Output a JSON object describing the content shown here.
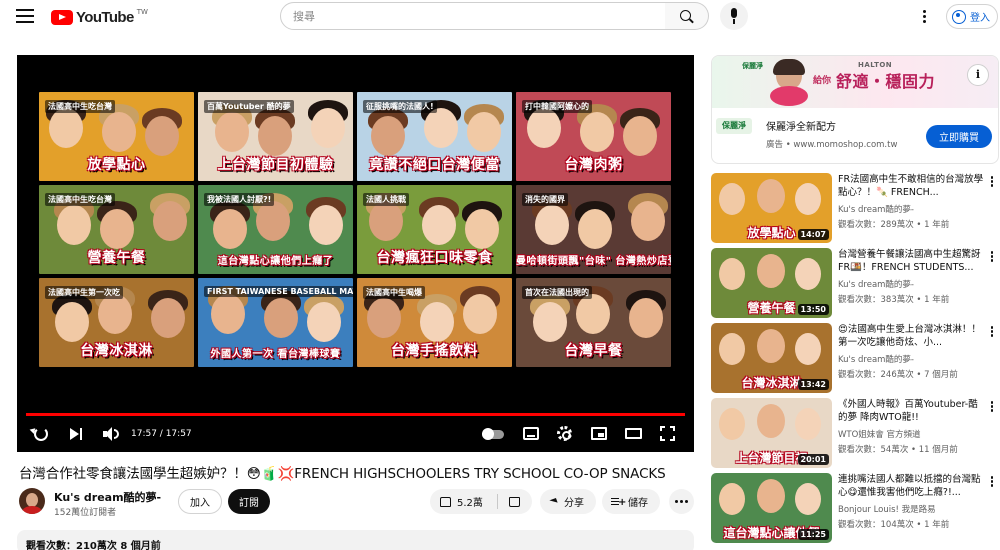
{
  "header": {
    "logo_text": "YouTube",
    "region": "TW",
    "search_placeholder": "搜尋",
    "signin_label": "登入"
  },
  "player": {
    "tiles": [
      {
        "sub": "法國高中生吃台灣",
        "caption": "放學點心",
        "bg": "#e3a02a"
      },
      {
        "sub": "百萬Youtuber 酷的夢",
        "caption": "上台灣節目初體驗",
        "bg": "#e8d8c6"
      },
      {
        "sub": "征服挑嘴的法國人!",
        "caption": "竟讚不絕口台灣便當",
        "bg": "#b9d3e6"
      },
      {
        "sub": "打中韓國阿嬤心的",
        "caption": "台灣肉粥",
        "bg": "#c04a56"
      },
      {
        "sub": "法國高中生吃台灣",
        "caption": "營養午餐",
        "bg": "#6e8a3a"
      },
      {
        "sub": "我被法國人討厭?!",
        "caption": "這台灣點心讓他們上癮了",
        "bg": "#4f8a4e"
      },
      {
        "sub": "法國人挑戰",
        "caption": "台灣瘋狂口味零食",
        "bg": "#7a9c3c"
      },
      {
        "sub": "消失的國界",
        "caption": "曼哈頓街頭飄\"台味\" 台灣熱炒店登富比士",
        "bg": "#5a3a34"
      },
      {
        "sub": "法國高中生第一次吃",
        "caption": "台灣冰淇淋",
        "bg": "#a8722e"
      },
      {
        "sub": "FIRST TAIWANESE BASEBALL MATCH!!",
        "caption": "外國人第一次 看台灣棒球賽",
        "bg": "#3c7fbe"
      },
      {
        "sub": "法國高中生喝爆",
        "caption": "台灣手搖飲料",
        "bg": "#cf8a3a"
      },
      {
        "sub": "首次在法國出現的",
        "caption": "台灣早餐",
        "bg": "#6a4a3a"
      }
    ],
    "progress": 1.0,
    "time_current": "17:57",
    "time_total": "17:57"
  },
  "video": {
    "title": "台灣合作社零食讓法國學生超嫉妒？！😳🧃💢FRENCH HIGHSCHOOLERS TRY SCHOOL CO-OP SNACKS",
    "channel_name": "Ku's dream酷的夢-",
    "subscribers": "152萬位訂閱者",
    "join_label": "加入",
    "subscribe_label": "訂閱",
    "likes": "5.2萬",
    "share_label": "分享",
    "save_label": "儲存",
    "description_meta": "觀看次數：210萬次  8 個月前"
  },
  "ad": {
    "brand_tag": "保麗淨",
    "partner": "HALTON",
    "lead_text": "給你",
    "headline": "舒適・穩固力",
    "title": "保麗淨全新配方",
    "sponsor_line": "廣告 • www.momoshop.com.tw",
    "cta_label": "立即購買",
    "logo_text": "保麗淨"
  },
  "recommendations": [
    {
      "title": "FR法國高中生不敢相信的台灣放學點心？！🍡 FRENCH...",
      "channel": "Ku's dream酷的夢-",
      "meta": "觀看次數：289萬次 • 1 年前",
      "duration": "14:07",
      "thumb_caption": "放學點心",
      "thumb_bg": "#e3a02a"
    },
    {
      "title": "台灣營養午餐讓法國高中生超驚訝FR🍱！FRENCH STUDENTS...",
      "channel": "Ku's dream酷的夢-",
      "meta": "觀看次數：383萬次 • 1 年前",
      "duration": "13:50",
      "thumb_caption": "營養午餐",
      "thumb_bg": "#6e8a3a"
    },
    {
      "title": "😍法國高中生愛上台灣冰淇淋！！第一次吃讓他奇炫、小...",
      "channel": "Ku's dream酷的夢-",
      "meta": "觀看次數：246萬次 • 7 個月前",
      "duration": "13:42",
      "thumb_caption": "台灣冰淇淋",
      "thumb_bg": "#a8722e"
    },
    {
      "title": "《外國人時報》百萬Youtuber-酷的夢 降肉WTO龍!!",
      "channel": "WTO姐妹會 官方頻道",
      "meta": "觀看次數：54萬次 • 11 個月前",
      "duration": "20:01",
      "thumb_caption": "上台灣節目初",
      "thumb_bg": "#e8d8c6"
    },
    {
      "title": "連挑嘴法國人都難以抵擋的台灣點心😋還惟我害他們吃上癮?!...",
      "channel": "Bonjour Louis! 我是路易",
      "meta": "觀看次數：104萬次 • 1 年前",
      "duration": "11:25",
      "thumb_caption": "這台灣點心讓他們",
      "thumb_bg": "#4f8a4e"
    }
  ]
}
